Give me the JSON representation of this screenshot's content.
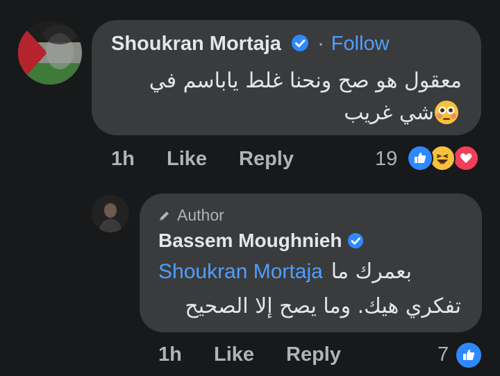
{
  "comment": {
    "author": "Shoukran Mortaja",
    "separator": "·",
    "follow_label": "Follow",
    "text_line1": "معقول هو صح ونحنا غلط ياباسم في",
    "text_line2": "شي غريب",
    "emoji": "flushed-face",
    "time": "1h",
    "like_label": "Like",
    "reply_label": "Reply",
    "reaction_count": "19",
    "reactions": [
      "like",
      "haha",
      "love"
    ]
  },
  "reply": {
    "badge_label": "Author",
    "author": "Bassem Moughnieh",
    "mention": "Shoukran Mortaja",
    "text_line1_tail": "بعمرك ما",
    "text_line2": "تفكري هيك. وما يصح إلا الصحيح",
    "time": "1h",
    "like_label": "Like",
    "reply_label": "Reply",
    "reaction_count": "7",
    "reactions": [
      "like"
    ]
  },
  "colors": {
    "background": "#18191a",
    "bubble": "#3a3b3c",
    "link": "#4e9fff",
    "verified": "#2e89ff",
    "secondary_text": "#b0b3b8"
  }
}
